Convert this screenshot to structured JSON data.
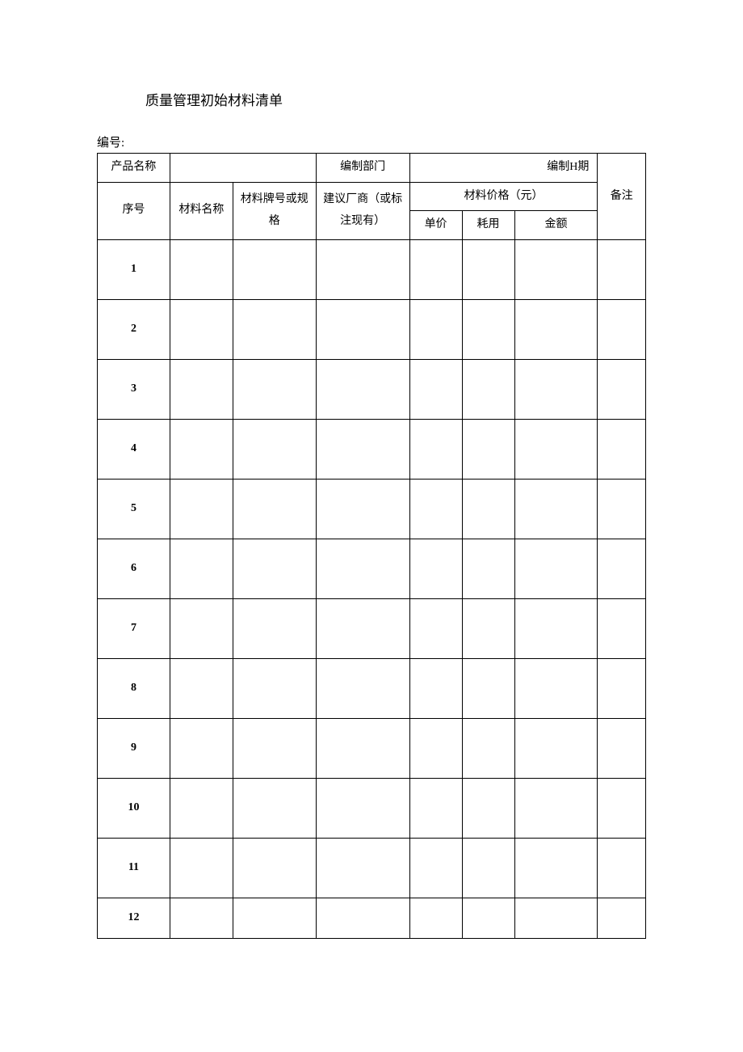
{
  "title": "质量管理初始材料清单",
  "label_number": "编号:",
  "header": {
    "product_name": "产品名称",
    "dept": "编制部门",
    "date": "编制H期",
    "seq": "序号",
    "mat_name": "材料名称",
    "mat_no": "材料牌号或规格",
    "factory": "建议厂商（或标注现有）",
    "price_group": "材料价格（元）",
    "unit_price": "单价",
    "usage": "耗用",
    "amount": "金额",
    "remark": "备注"
  },
  "rows": [
    {
      "seq": "1"
    },
    {
      "seq": "2"
    },
    {
      "seq": "3"
    },
    {
      "seq": "4"
    },
    {
      "seq": "5"
    },
    {
      "seq": "6"
    },
    {
      "seq": "7"
    },
    {
      "seq": "8"
    },
    {
      "seq": "9"
    },
    {
      "seq": "10"
    },
    {
      "seq": "11"
    },
    {
      "seq": "12"
    }
  ]
}
